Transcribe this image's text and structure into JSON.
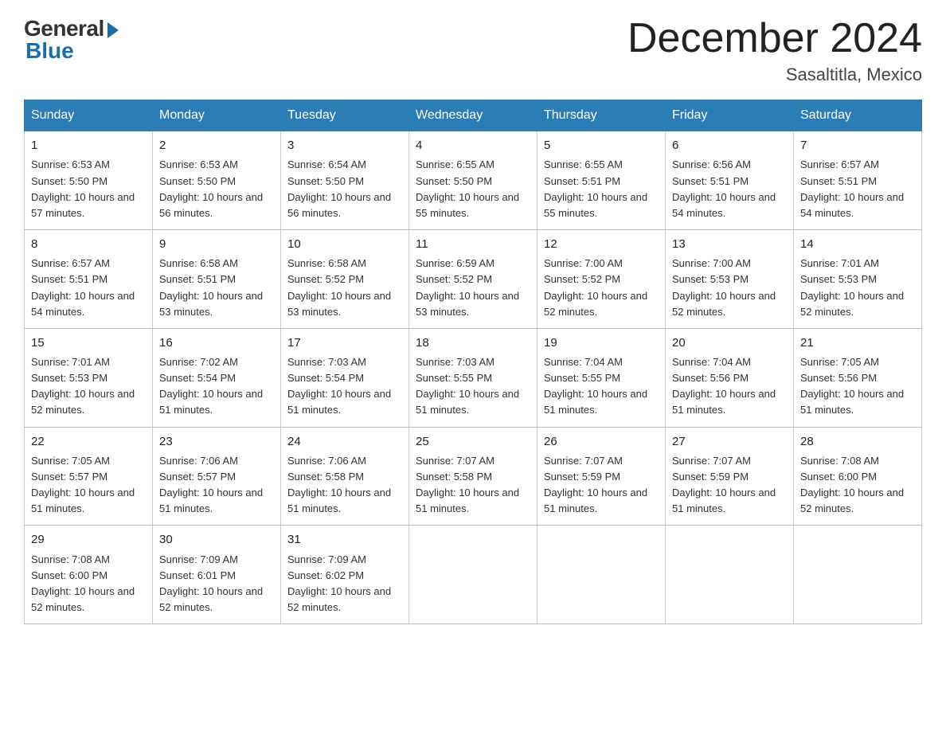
{
  "logo": {
    "general": "General",
    "blue": "Blue"
  },
  "title": {
    "month_year": "December 2024",
    "location": "Sasaltitla, Mexico"
  },
  "days_of_week": [
    "Sunday",
    "Monday",
    "Tuesday",
    "Wednesday",
    "Thursday",
    "Friday",
    "Saturday"
  ],
  "weeks": [
    [
      {
        "day": "1",
        "sunrise": "6:53 AM",
        "sunset": "5:50 PM",
        "daylight": "10 hours and 57 minutes."
      },
      {
        "day": "2",
        "sunrise": "6:53 AM",
        "sunset": "5:50 PM",
        "daylight": "10 hours and 56 minutes."
      },
      {
        "day": "3",
        "sunrise": "6:54 AM",
        "sunset": "5:50 PM",
        "daylight": "10 hours and 56 minutes."
      },
      {
        "day": "4",
        "sunrise": "6:55 AM",
        "sunset": "5:50 PM",
        "daylight": "10 hours and 55 minutes."
      },
      {
        "day": "5",
        "sunrise": "6:55 AM",
        "sunset": "5:51 PM",
        "daylight": "10 hours and 55 minutes."
      },
      {
        "day": "6",
        "sunrise": "6:56 AM",
        "sunset": "5:51 PM",
        "daylight": "10 hours and 54 minutes."
      },
      {
        "day": "7",
        "sunrise": "6:57 AM",
        "sunset": "5:51 PM",
        "daylight": "10 hours and 54 minutes."
      }
    ],
    [
      {
        "day": "8",
        "sunrise": "6:57 AM",
        "sunset": "5:51 PM",
        "daylight": "10 hours and 54 minutes."
      },
      {
        "day": "9",
        "sunrise": "6:58 AM",
        "sunset": "5:51 PM",
        "daylight": "10 hours and 53 minutes."
      },
      {
        "day": "10",
        "sunrise": "6:58 AM",
        "sunset": "5:52 PM",
        "daylight": "10 hours and 53 minutes."
      },
      {
        "day": "11",
        "sunrise": "6:59 AM",
        "sunset": "5:52 PM",
        "daylight": "10 hours and 53 minutes."
      },
      {
        "day": "12",
        "sunrise": "7:00 AM",
        "sunset": "5:52 PM",
        "daylight": "10 hours and 52 minutes."
      },
      {
        "day": "13",
        "sunrise": "7:00 AM",
        "sunset": "5:53 PM",
        "daylight": "10 hours and 52 minutes."
      },
      {
        "day": "14",
        "sunrise": "7:01 AM",
        "sunset": "5:53 PM",
        "daylight": "10 hours and 52 minutes."
      }
    ],
    [
      {
        "day": "15",
        "sunrise": "7:01 AM",
        "sunset": "5:53 PM",
        "daylight": "10 hours and 52 minutes."
      },
      {
        "day": "16",
        "sunrise": "7:02 AM",
        "sunset": "5:54 PM",
        "daylight": "10 hours and 51 minutes."
      },
      {
        "day": "17",
        "sunrise": "7:03 AM",
        "sunset": "5:54 PM",
        "daylight": "10 hours and 51 minutes."
      },
      {
        "day": "18",
        "sunrise": "7:03 AM",
        "sunset": "5:55 PM",
        "daylight": "10 hours and 51 minutes."
      },
      {
        "day": "19",
        "sunrise": "7:04 AM",
        "sunset": "5:55 PM",
        "daylight": "10 hours and 51 minutes."
      },
      {
        "day": "20",
        "sunrise": "7:04 AM",
        "sunset": "5:56 PM",
        "daylight": "10 hours and 51 minutes."
      },
      {
        "day": "21",
        "sunrise": "7:05 AM",
        "sunset": "5:56 PM",
        "daylight": "10 hours and 51 minutes."
      }
    ],
    [
      {
        "day": "22",
        "sunrise": "7:05 AM",
        "sunset": "5:57 PM",
        "daylight": "10 hours and 51 minutes."
      },
      {
        "day": "23",
        "sunrise": "7:06 AM",
        "sunset": "5:57 PM",
        "daylight": "10 hours and 51 minutes."
      },
      {
        "day": "24",
        "sunrise": "7:06 AM",
        "sunset": "5:58 PM",
        "daylight": "10 hours and 51 minutes."
      },
      {
        "day": "25",
        "sunrise": "7:07 AM",
        "sunset": "5:58 PM",
        "daylight": "10 hours and 51 minutes."
      },
      {
        "day": "26",
        "sunrise": "7:07 AM",
        "sunset": "5:59 PM",
        "daylight": "10 hours and 51 minutes."
      },
      {
        "day": "27",
        "sunrise": "7:07 AM",
        "sunset": "5:59 PM",
        "daylight": "10 hours and 51 minutes."
      },
      {
        "day": "28",
        "sunrise": "7:08 AM",
        "sunset": "6:00 PM",
        "daylight": "10 hours and 52 minutes."
      }
    ],
    [
      {
        "day": "29",
        "sunrise": "7:08 AM",
        "sunset": "6:00 PM",
        "daylight": "10 hours and 52 minutes."
      },
      {
        "day": "30",
        "sunrise": "7:09 AM",
        "sunset": "6:01 PM",
        "daylight": "10 hours and 52 minutes."
      },
      {
        "day": "31",
        "sunrise": "7:09 AM",
        "sunset": "6:02 PM",
        "daylight": "10 hours and 52 minutes."
      },
      null,
      null,
      null,
      null
    ]
  ],
  "cell_labels": {
    "sunrise": "Sunrise: ",
    "sunset": "Sunset: ",
    "daylight": "Daylight: "
  }
}
